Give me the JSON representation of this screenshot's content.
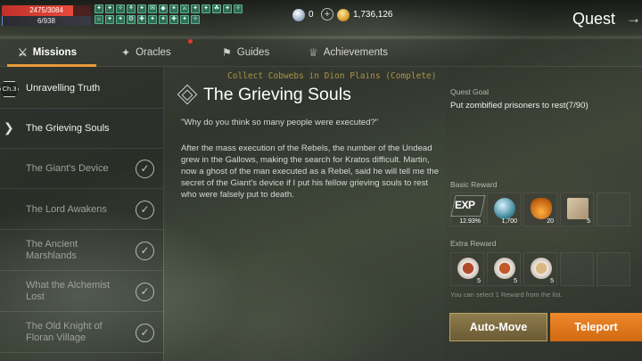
{
  "status": {
    "hp": "2475/3084",
    "hp_fraction": 0.8,
    "mp": "6/938",
    "mp_fraction": 0.006
  },
  "buff_icons": [
    "✦",
    "✦",
    "✧",
    "⚘",
    "✦",
    "✉",
    "◆",
    "✴",
    "⚔",
    "✦",
    "✦",
    "☘",
    "✦",
    "✧",
    "☼",
    "✦",
    "✦",
    "⚙",
    "✚",
    "✦",
    "✦",
    "✚",
    "✦",
    "✧"
  ],
  "currency": {
    "gems": "0",
    "gems_add": "+",
    "gold": "1,736,126"
  },
  "header": {
    "title": "Quest",
    "exit_icon": "→"
  },
  "tabs": [
    {
      "label": "Missions",
      "icon": "⚔",
      "active": true
    },
    {
      "label": "Oracles",
      "icon": "✦",
      "has_alert": true
    },
    {
      "label": "Guides",
      "icon": "⚑"
    },
    {
      "label": "Achievements",
      "icon": "♕"
    }
  ],
  "sub_objective": "Collect Cobwebs in Dion Plains (Complete)",
  "chapter": {
    "badge": "Ch.3",
    "title": "Unravelling Truth",
    "items": [
      {
        "label": "The Grieving Souls",
        "selected": true
      },
      {
        "label": "The Giant's Device",
        "done": true
      },
      {
        "label": "The Lord Awakens",
        "done": true
      },
      {
        "label": "The Ancient Marshlands",
        "done": true
      },
      {
        "label": "What the Alchemist Lost",
        "done": true
      },
      {
        "label": "The Old Knight of Floran Village",
        "done": true
      }
    ],
    "selected_arrow": "❯",
    "check_glyph": "✓"
  },
  "mission": {
    "title": "The Grieving Souls",
    "quote": "\"Why do you think so many people were executed?\"",
    "description": "After the mass execution of the Rebels, the number of the Undead grew in the Gallows, making the search for Kratos difficult. Martin, now a ghost of the man executed as a Rebel, said he will tell me the secret of the Giant's device if I put his fellow grieving souls to rest who were falsely put to death."
  },
  "goal": {
    "label": "Quest Goal",
    "text": "Put zombified prisoners to rest(7/90)"
  },
  "basic_reward": {
    "label": "Basic Reward",
    "items": [
      {
        "name": "exp",
        "icon_text": "EXP",
        "qty": "12.93%"
      },
      {
        "name": "orb",
        "qty": "1,700"
      },
      {
        "name": "potion",
        "qty": "20"
      },
      {
        "name": "scroll",
        "qty": "5"
      }
    ]
  },
  "extra_reward": {
    "label": "Extra Reward",
    "items": [
      {
        "name": "steak-dish",
        "qty": "5"
      },
      {
        "name": "skewer-dish",
        "qty": "5"
      },
      {
        "name": "bread-dish",
        "qty": "5"
      }
    ],
    "note": "You can select 1 Reward from the list."
  },
  "buttons": {
    "auto_move": "Auto-Move",
    "teleport": "Teleport"
  }
}
